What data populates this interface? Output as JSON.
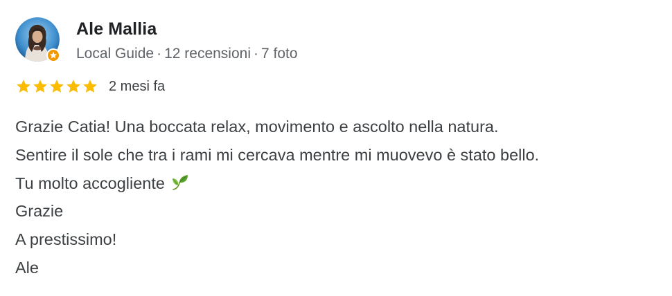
{
  "review": {
    "author": {
      "name": "Ale Mallia",
      "badge": "Local Guide",
      "separator": "·",
      "reviews_count": "12 recensioni",
      "photos_count": "7 foto",
      "avatar_icon": "user-avatar-photo",
      "guide_badge_icon": "local-guide-star-badge"
    },
    "rating": {
      "stars": 5,
      "max": 5,
      "star_color": "#fbbc04"
    },
    "time_ago": "2 mesi fa",
    "text_lines": [
      "Grazie Catia! Una boccata relax, movimento e ascolto nella natura.",
      "Sentire il sole che tra i rami mi cercava mentre mi muovevo è stato bello.",
      "Tu molto accogliente",
      "Grazie",
      "A prestissimo!",
      "Ale"
    ],
    "emoji_icon": "leafy-green-icon"
  },
  "colors": {
    "text_primary": "#202124",
    "text_body": "#3c4043",
    "text_secondary": "#5f6368",
    "badge_orange": "#f29900"
  }
}
